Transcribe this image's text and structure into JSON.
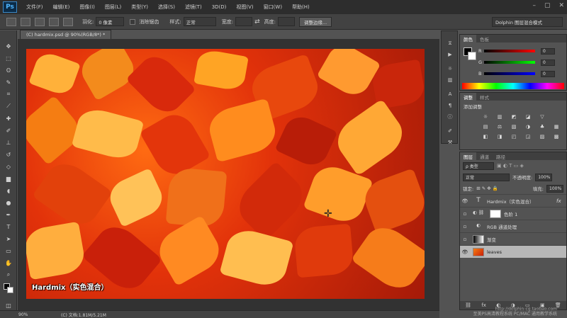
{
  "app": {
    "logo": "Ps"
  },
  "menubar": {
    "items": [
      "文件(F)",
      "编辑(E)",
      "图像(I)",
      "图层(L)",
      "类型(Y)",
      "选择(S)",
      "滤镜(T)",
      "3D(D)",
      "视图(V)",
      "窗口(W)",
      "帮助(H)"
    ],
    "window_controls": [
      "–",
      "▢",
      "✕"
    ]
  },
  "options": {
    "feather_label": "羽化:",
    "feather_value": "0 像素",
    "antialias_label": "消除锯齿",
    "style_label": "样式:",
    "style_value": "正常",
    "width_label": "宽度:",
    "height_label": "高度:",
    "refine_edge": "调整边缘...",
    "workspace": "Dolphin 图层混合模式"
  },
  "document": {
    "tab_title": "(C) hardmix.psd @ 90%(RGB/8*) *",
    "caption": "Hardmix（实色混合）"
  },
  "status": {
    "zoom": "90%",
    "doc_info": "(C) 文档:1.81M/5.21M"
  },
  "color_panel": {
    "tabs": [
      "颜色",
      "色板"
    ],
    "sliders": [
      {
        "label": "R",
        "value": "0"
      },
      {
        "label": "G",
        "value": "0"
      },
      {
        "label": "B",
        "value": "0"
      }
    ]
  },
  "adjustments_panel": {
    "tabs": [
      "调整",
      "样式"
    ],
    "title": "添加调整",
    "icons": [
      "☼",
      "▥",
      "◩",
      "◪",
      "▽",
      "",
      "▤",
      "⚖",
      "▧",
      "◑",
      "♣",
      "▦",
      "◧",
      "◨",
      "◰",
      "◲",
      "▨",
      "▩"
    ]
  },
  "layers_panel": {
    "tabs": [
      "图层",
      "通道",
      "路径"
    ],
    "filter_label": "ρ 类型",
    "blend_mode": "正常",
    "opacity_label": "不透明度:",
    "opacity_value": "100%",
    "lock_label": "锁定:",
    "fill_label": "填充:",
    "fill_value": "100%",
    "layers": [
      {
        "name": "Hardmix（实色混合）",
        "type": "text",
        "visible": true,
        "fx": "fx"
      },
      {
        "name": "色阶 1",
        "type": "adjustment",
        "visible": false,
        "fx": ""
      },
      {
        "name": "RGB 通道处理",
        "type": "group",
        "visible": false,
        "fx": ""
      },
      {
        "name": "渐变",
        "type": "gradient",
        "visible": false,
        "fx": ""
      },
      {
        "name": "leaves",
        "type": "image",
        "visible": true,
        "fx": ""
      }
    ],
    "footer_icons": [
      "⛓",
      "fx",
      "◐",
      "◑",
      "▭",
      "▣",
      "🗑"
    ]
  },
  "watermark": {
    "line1": "http://dolphin-cg.taobao.com",
    "line2": "至美PS高清教程系统 PC/MAC 通用教学系统"
  }
}
